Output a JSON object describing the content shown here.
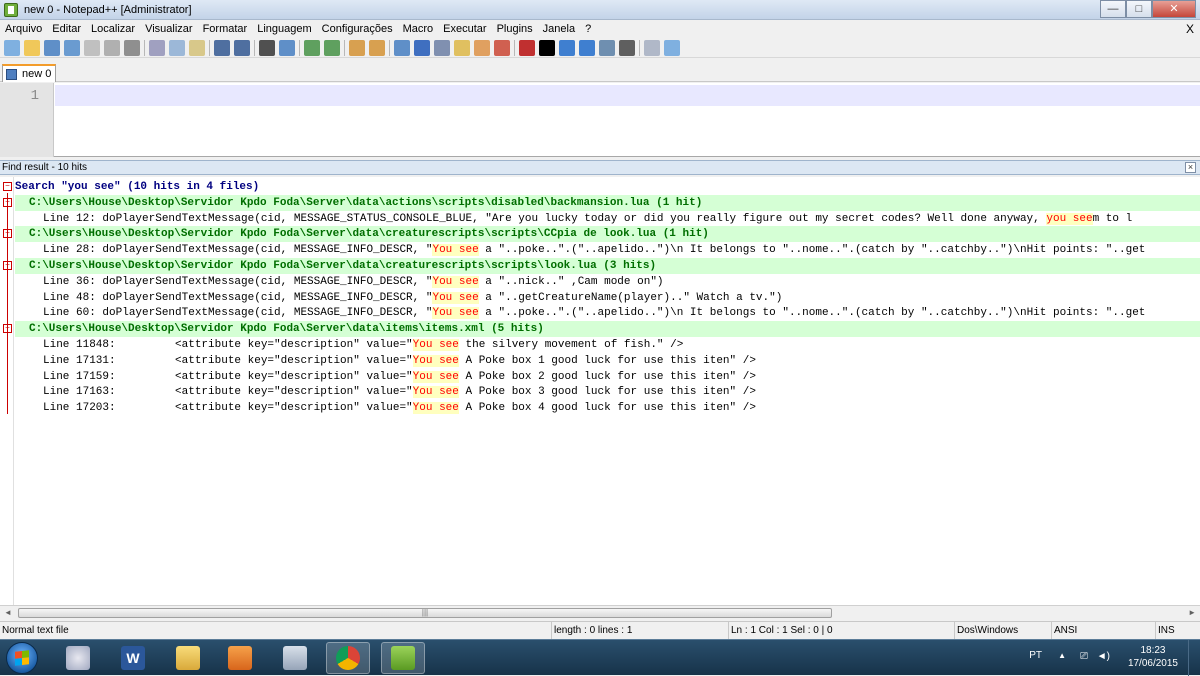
{
  "window": {
    "title": "new  0 - Notepad++ [Administrator]",
    "minimize": "—",
    "maximize": "□",
    "close": "✕"
  },
  "menu": {
    "items": [
      "Arquivo",
      "Editar",
      "Localizar",
      "Visualizar",
      "Formatar",
      "Linguagem",
      "Configurações",
      "Macro",
      "Executar",
      "Plugins",
      "Janela",
      "?"
    ],
    "close_doc": "X"
  },
  "toolbar": {
    "icons": [
      "new-file-icon",
      "open-file-icon",
      "save-icon",
      "save-all-icon",
      "close-icon",
      "close-all-icon",
      "print-icon",
      "cut-icon",
      "copy-icon",
      "paste-icon",
      "undo-icon",
      "redo-icon",
      "find-icon",
      "replace-icon",
      "zoom-in-icon",
      "zoom-out-icon",
      "sync-vertical-icon",
      "sync-horizontal-icon",
      "word-wrap-icon",
      "show-all-chars-icon",
      "indent-guide-icon",
      "doc-map-icon",
      "function-list-icon",
      "folder-workspace-icon",
      "monitor-icon",
      "record-macro-icon",
      "stop-macro-icon",
      "play-macro-icon",
      "run-macro-multiple-icon",
      "save-macro-icon",
      "spellcheck-icon",
      "spellcheck-settings-icon"
    ]
  },
  "tab": {
    "label": "new 0"
  },
  "editor": {
    "line_number": "1"
  },
  "find_panel": {
    "title": "Find result - 10 hits",
    "close": "×",
    "search_line": "Search \"you see\" (10 hits in 4 files)",
    "files": [
      {
        "path": "C:\\Users\\House\\Desktop\\Servidor Kpdo Foda\\Server\\data\\actions\\scripts\\disabled\\backmansion.lua (1 hit)",
        "hits": [
          {
            "pre": "Line 12: doPlayerSendTextMessage(cid, MESSAGE_STATUS_CONSOLE_BLUE, \"Are you lucky today or did you really figure out my secret codes? Well done anyway, ",
            "match": "you see",
            "post": "m to l"
          }
        ]
      },
      {
        "path": "C:\\Users\\House\\Desktop\\Servidor Kpdo Foda\\Server\\data\\creaturescripts\\scripts\\CCpia de look.lua (1 hit)",
        "hits": [
          {
            "pre": "Line 28: doPlayerSendTextMessage(cid, MESSAGE_INFO_DESCR, \"",
            "match": "You see",
            "post": " a \"..poke..\".(\"..apelido..\")\\n It belongs to \"..nome..\".(catch by \"..catchby..\")\\nHit points: \"..get"
          }
        ]
      },
      {
        "path": "C:\\Users\\House\\Desktop\\Servidor Kpdo Foda\\Server\\data\\creaturescripts\\scripts\\look.lua (3 hits)",
        "hits": [
          {
            "pre": "Line 36: doPlayerSendTextMessage(cid, MESSAGE_INFO_DESCR, \"",
            "match": "You see",
            "post": " a \"..nick..\" ,Cam mode on\")"
          },
          {
            "pre": "Line 48: doPlayerSendTextMessage(cid, MESSAGE_INFO_DESCR, \"",
            "match": "You see",
            "post": " a \"..getCreatureName(player)..\" Watch a tv.\")"
          },
          {
            "pre": "Line 60: doPlayerSendTextMessage(cid, MESSAGE_INFO_DESCR, \"",
            "match": "You see",
            "post": " a \"..poke..\".(\"..apelido..\")\\n It belongs to \"..nome..\".(catch by \"..catchby..\")\\nHit points: \"..get"
          }
        ]
      },
      {
        "path": "C:\\Users\\House\\Desktop\\Servidor Kpdo Foda\\Server\\data\\items\\items.xml (5 hits)",
        "hits": [
          {
            "pre": "Line 11848:         <attribute key=\"description\" value=\"",
            "match": "You see",
            "post": " the silvery movement of fish.\" />"
          },
          {
            "pre": "Line 17131:         <attribute key=\"description\" value=\"",
            "match": "You see",
            "post": " A Poke box 1 good luck for use this iten\" />"
          },
          {
            "pre": "Line 17159:         <attribute key=\"description\" value=\"",
            "match": "You see",
            "post": " A Poke box 2 good luck for use this iten\" />"
          },
          {
            "pre": "Line 17163:         <attribute key=\"description\" value=\"",
            "match": "You see",
            "post": " A Poke box 3 good luck for use this iten\" />"
          },
          {
            "pre": "Line 17203:         <attribute key=\"description\" value=\"",
            "match": "You see",
            "post": " A Poke box 4 good luck for use this iten\" />"
          }
        ]
      }
    ]
  },
  "scrollbar": {
    "left_arrow": "◄",
    "right_arrow": "►",
    "grip": "|||"
  },
  "status": {
    "file_type": "Normal text file",
    "length": "length : 0    lines : 1",
    "position": "Ln : 1    Col : 1    Sel : 0 | 0",
    "eol": "Dos\\Windows",
    "encoding": "ANSI",
    "mode": "INS"
  },
  "taskbar": {
    "apps": [
      "paint-icon",
      "word-icon",
      "explorer-icon",
      "media-player-icon",
      "calculator-icon",
      "chrome-icon",
      "notepadpp-icon"
    ],
    "language": "PT",
    "tray_arrow": "▲",
    "network": "⎚",
    "volume": "◄)",
    "time": "18:23",
    "date": "17/06/2015"
  },
  "colors": {
    "file_row_bg": "#d5ffd5",
    "file_row_fg": "#006e00",
    "match_fg": "#ff0000",
    "match_bg": "#ffffbf",
    "search_fg": "#000080"
  }
}
